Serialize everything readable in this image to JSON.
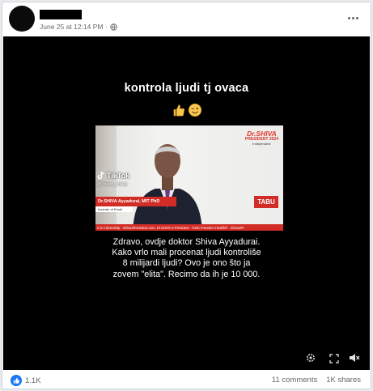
{
  "post": {
    "timestamp": "June 25 at 12:14 PM",
    "separator": "·",
    "privacy_icon": "globe-icon",
    "more_icon": "more-options-icon"
  },
  "video": {
    "caption_top": "kontrola ljudi tj ovaca",
    "emojis": [
      "thumbs-up-emoji",
      "winking-face-emoji"
    ],
    "overlay": {
      "logo_line1": "Dr.SHIVA",
      "logo_line2": "PRESIDENT 2024",
      "logo_line3": "Independent",
      "tiktok_label": "TikTok",
      "tiktok_user": "@ nikon_shally",
      "name_bar": "Dr.SHIVA Ayyadurai, MIT PhD",
      "sub_bar": "Inventor of Email",
      "tabu": "TABU",
      "ticker": "e is Citizenship · Shiva4President.com, Dr.SHIVA 4 President · Truth Freedom Health® · Shiva4Pr"
    },
    "caption_body": [
      "Zdravo, ovdje doktor Shiva Ayyadurai.",
      "Kako vrlo mali procenat ljudi kontroliše",
      "8 milijardi ljudi? Ovo je ono što ja",
      "zovem \"elita\". Recimo da ih je 10 000."
    ],
    "controls": [
      "settings-icon",
      "fullscreen-icon",
      "mute-icon"
    ]
  },
  "footer": {
    "reaction_icon": "like-icon",
    "reactions_count": "1.1K",
    "comments": "11 comments",
    "shares": "1K shares"
  },
  "colors": {
    "accent": "#1877f2",
    "tabu_red": "#d12c25",
    "meta_text": "#65676b"
  }
}
